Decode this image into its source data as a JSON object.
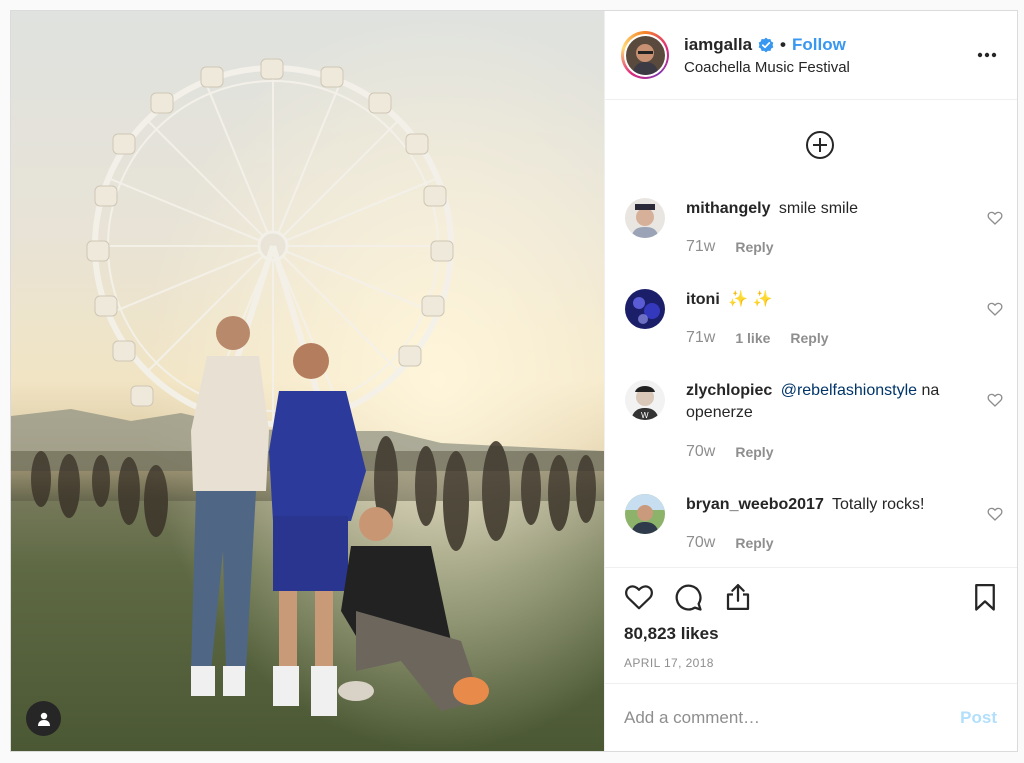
{
  "post": {
    "username": "iamgalla",
    "verified_icon": "verified-badge-icon",
    "separator": "•",
    "follow_label": "Follow",
    "location": "Coachella Music Festival",
    "more_icon": "more-options-icon",
    "photo_alt": "Three men posing in front of a Ferris wheel at Coachella"
  },
  "comments": [
    {
      "user": "mithangely",
      "text": "smile smile",
      "time": "71w",
      "likes": "",
      "reply": "Reply"
    },
    {
      "user": "itoni",
      "text": "✨ ✨",
      "time": "71w",
      "likes": "1 like",
      "reply": "Reply"
    },
    {
      "user": "zlychlopiec",
      "mention": "@rebelfashionstyle",
      "text": " na openerze",
      "time": "70w",
      "likes": "",
      "reply": "Reply"
    },
    {
      "user": "bryan_weebo2017",
      "text": "Totally rocks!",
      "time": "70w",
      "likes": "",
      "reply": "Reply"
    }
  ],
  "actions": {
    "likes": "80,823 likes",
    "date": "APRIL 17, 2018",
    "icons": [
      "heart-icon",
      "comment-icon",
      "share-icon",
      "bookmark-icon"
    ]
  },
  "comment_box": {
    "placeholder": "Add a comment…",
    "post_label": "Post"
  },
  "colors": {
    "link_blue": "#3897f0",
    "mention": "#003569",
    "muted": "#8e8e8e",
    "post_disabled": "#b2dffc"
  }
}
